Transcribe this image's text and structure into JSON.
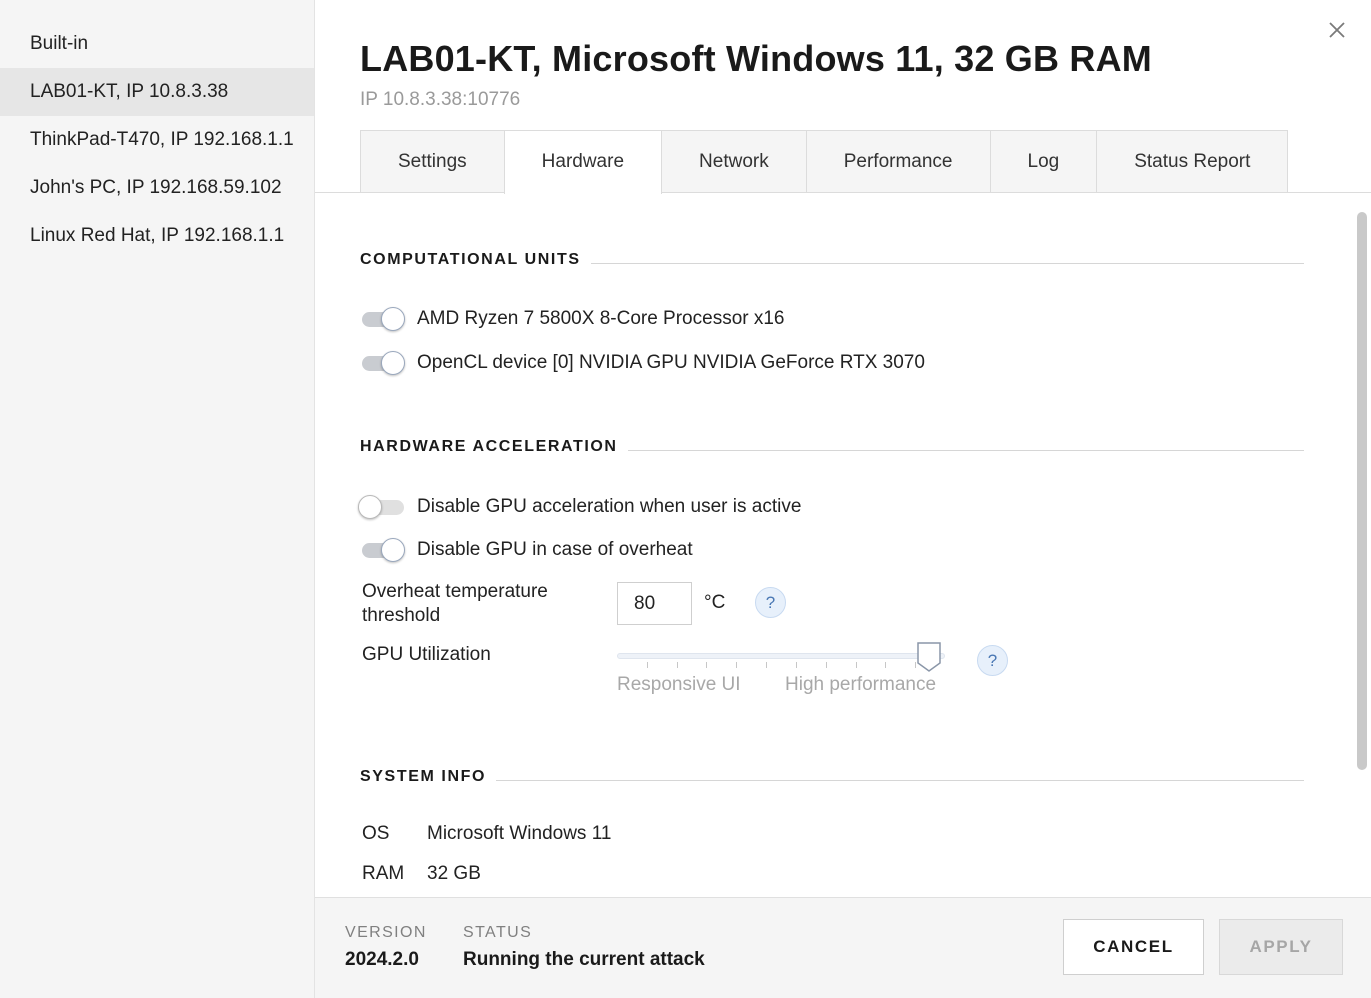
{
  "sidebar": {
    "items": [
      {
        "label": "Built-in"
      },
      {
        "label": "LAB01-KT, IP 10.8.3.38"
      },
      {
        "label": "ThinkPad-T470, IP 192.168.1.1"
      },
      {
        "label": "John's PC, IP 192.168.59.102"
      },
      {
        "label": "Linux Red Hat, IP 192.168.1.1"
      }
    ],
    "active_index": 1
  },
  "header": {
    "title": "LAB01-KT, Microsoft Windows 11, 32 GB RAM",
    "subtitle": "IP 10.8.3.38:10776",
    "close_icon": "close-icon"
  },
  "tabs": [
    {
      "label": "Settings"
    },
    {
      "label": "Hardware"
    },
    {
      "label": "Network"
    },
    {
      "label": "Performance"
    },
    {
      "label": "Log"
    },
    {
      "label": "Status Report"
    }
  ],
  "active_tab": "Hardware",
  "computational_units": {
    "heading": "COMPUTATIONAL UNITS",
    "items": [
      {
        "label": "AMD Ryzen 7 5800X 8-Core Processor x16",
        "enabled": true
      },
      {
        "label": "OpenCL device [0] NVIDIA GPU NVIDIA GeForce RTX 3070",
        "enabled": true
      }
    ]
  },
  "hardware_acceleration": {
    "heading": "HARDWARE ACCELERATION",
    "disable_when_active": {
      "label": "Disable GPU acceleration when user is active",
      "enabled": false
    },
    "disable_on_overheat": {
      "label": "Disable GPU in case of overheat",
      "enabled": true
    },
    "overheat_threshold": {
      "label": "Overheat temperature threshold",
      "value": "80",
      "unit": "°C",
      "help": "?"
    },
    "gpu_utilization": {
      "label": "GPU Utilization",
      "min_label": "Responsive UI",
      "max_label": "High performance",
      "level_fraction": 0.95,
      "help": "?"
    }
  },
  "system_info": {
    "heading": "SYSTEM INFO",
    "rows": [
      {
        "key": "OS",
        "value": "Microsoft Windows 11"
      },
      {
        "key": "RAM",
        "value": "32 GB"
      }
    ]
  },
  "footer": {
    "version_label": "VERSION",
    "version_value": "2024.2.0",
    "status_label": "STATUS",
    "status_value": "Running the current attack",
    "cancel_label": "CANCEL",
    "apply_label": "APPLY"
  },
  "colors": {
    "toggle_on_track": "#c9ccd1",
    "help_bg": "#e7f0fb",
    "help_text": "#4a78b4",
    "sidebar_bg": "#f5f5f5",
    "apply_disabled": "#a6a6a6"
  }
}
